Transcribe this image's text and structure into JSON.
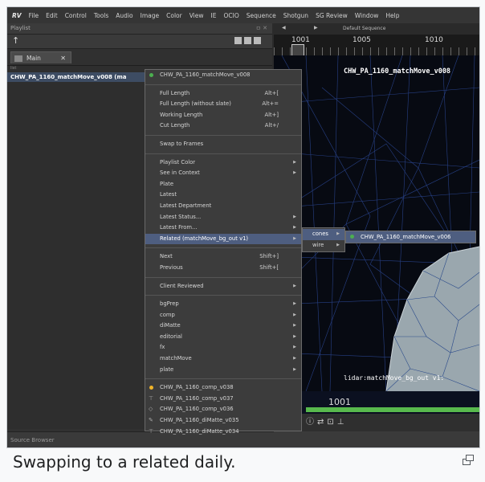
{
  "menubar": {
    "app": "RV",
    "items": [
      "File",
      "Edit",
      "Control",
      "Tools",
      "Audio",
      "Image",
      "Color",
      "View",
      "IE",
      "OCIO",
      "Sequence",
      "Shotgun",
      "SG Review",
      "Window",
      "Help"
    ]
  },
  "playlist": {
    "title": "Playlist",
    "close": "ㅁ ✕",
    "tab": "Main",
    "list_caption": "list",
    "selected_item": "CHW_PA_1160_matchMove_v008 (ma"
  },
  "source_browser": "Source Browser",
  "viewer": {
    "seq_label": "Default Sequence",
    "ruler": [
      "1001",
      "1005",
      "1010"
    ],
    "title": "CHW_PA_1160_matchMove_v008",
    "lidar": "lidar:matchMove_bg_out v1:",
    "frame": "1001"
  },
  "menu": {
    "header": "CHW_PA_1160_matchMove_v008",
    "items": [
      {
        "label": "Full Length",
        "shortcut": "Alt+["
      },
      {
        "label": "Full Length (without slate)",
        "shortcut": "Alt+="
      },
      {
        "label": "Working Length",
        "shortcut": "Alt+]"
      },
      {
        "label": "Cut Length",
        "shortcut": "Alt+/"
      },
      {
        "label": "Swap to Frames"
      },
      {
        "label": "Playlist Color"
      },
      {
        "label": "See in Context"
      },
      {
        "label": "Plate"
      },
      {
        "label": "Latest"
      },
      {
        "label": "Latest Department"
      },
      {
        "label": "Latest Status..."
      },
      {
        "label": "Latest From..."
      },
      {
        "label": "Related (matchMove_bg_out v1)"
      },
      {
        "label": "Next",
        "shortcut": "Shift+]"
      },
      {
        "label": "Previous",
        "shortcut": "Shift+["
      },
      {
        "label": "Client Reviewed"
      },
      {
        "label": "bgPrep"
      },
      {
        "label": "comp"
      },
      {
        "label": "diMatte"
      },
      {
        "label": "editorial"
      },
      {
        "label": "fx"
      },
      {
        "label": "matchMove"
      },
      {
        "label": "plate"
      },
      {
        "label": "CHW_PA_1160_comp_v038"
      },
      {
        "label": "CHW_PA_1160_comp_v037"
      },
      {
        "label": "CHW_PA_1160_comp_v036"
      },
      {
        "label": "CHW_PA_1160_diMatte_v035"
      },
      {
        "label": "CHW_PA_1160_diMatte_v034"
      }
    ],
    "related_sub": [
      "cones",
      "wire"
    ],
    "cones_sub": "CHW_PA_1160_matchMove_v006"
  },
  "colors": {
    "highlight": "#4e5e80",
    "status_green": "#4caf50",
    "status_yellow": "#f0b429",
    "mesh": "#2d4a9a"
  },
  "caption": "Swapping to a related daily."
}
